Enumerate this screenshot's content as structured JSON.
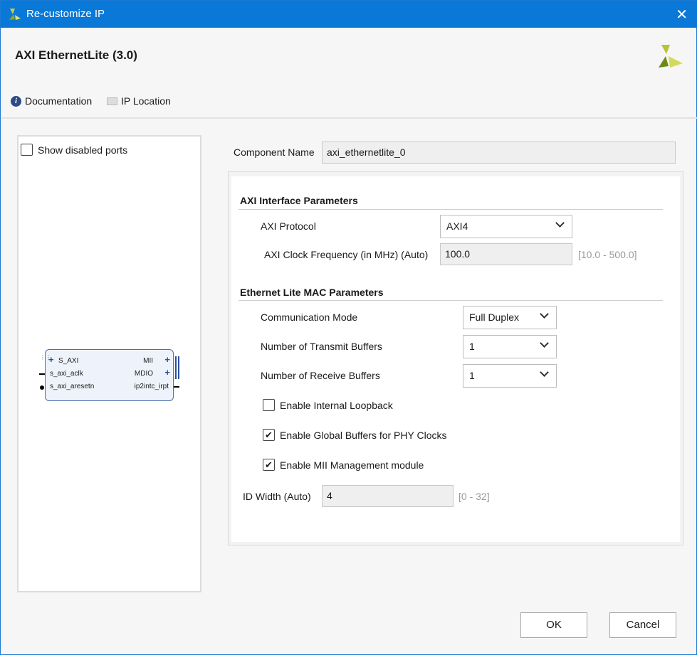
{
  "window": {
    "title": "Re-customize IP",
    "close": "✕"
  },
  "header": {
    "ip_title": "AXI EthernetLite (3.0)",
    "documentation": "Documentation",
    "ip_location": "IP Location"
  },
  "left": {
    "show_disabled_ports": "Show disabled ports",
    "show_disabled_checked": false,
    "block": {
      "left_ports": [
        "S_AXI",
        "s_axi_aclk",
        "s_axi_aresetn"
      ],
      "right_ports": [
        "MII",
        "MDIO",
        "ip2intc_irpt"
      ]
    }
  },
  "component": {
    "label": "Component Name",
    "value": "axi_ethernetlite_0"
  },
  "axi": {
    "section": "AXI Interface Parameters",
    "protocol_label": "AXI Protocol",
    "protocol_value": "AXI4",
    "clock_label": "AXI Clock Frequency (in MHz) (Auto)",
    "clock_value": "100.0",
    "clock_range": "[10.0 - 500.0]"
  },
  "mac": {
    "section": "Ethernet Lite MAC Parameters",
    "comm_label": "Communication Mode",
    "comm_value": "Full Duplex",
    "tx_label": "Number of Transmit Buffers",
    "tx_value": "1",
    "rx_label": "Number of Receive Buffers",
    "rx_value": "1",
    "loopback_label": "Enable Internal Loopback",
    "loopback_checked": false,
    "global_buf_label": "Enable Global Buffers for PHY Clocks",
    "global_buf_checked": true,
    "mii_label": "Enable MII Management module",
    "mii_checked": true,
    "id_label": "ID Width (Auto)",
    "id_value": "4",
    "id_range": "[0 - 32]"
  },
  "buttons": {
    "ok": "OK",
    "cancel": "Cancel"
  },
  "colors": {
    "titlebar": "#0a78d6",
    "logo_green": "#8db32a",
    "logo_olive": "#5b6b12"
  }
}
